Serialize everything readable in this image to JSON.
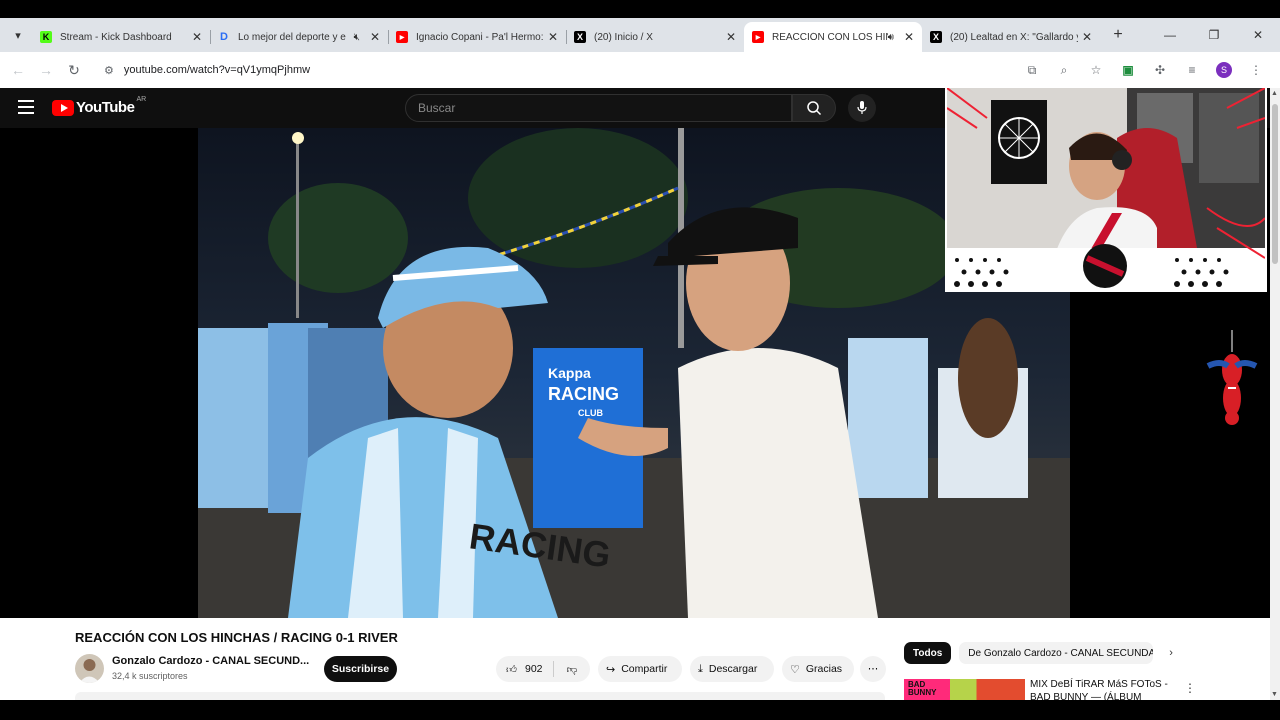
{
  "browser": {
    "tabs": [
      {
        "title": "Stream - Kick Dashboard",
        "favicon": "kick-icon",
        "active": false,
        "audio": ""
      },
      {
        "title": "Lo mejor del deporte y e",
        "favicon": "dplus-icon",
        "active": false,
        "audio": "muted"
      },
      {
        "title": "Ignacio Copani - Pa'l Hermo:",
        "favicon": "youtube-icon",
        "active": false,
        "audio": ""
      },
      {
        "title": "(20) Inicio / X",
        "favicon": "x-icon",
        "active": false,
        "audio": ""
      },
      {
        "title": "REACCIÓN CON LOS HIN",
        "favicon": "youtube-icon",
        "active": true,
        "audio": "playing"
      },
      {
        "title": "(20) Lealtad en X: \"Gallardo y",
        "favicon": "x-icon",
        "active": false,
        "audio": ""
      }
    ],
    "url": "youtube.com/watch?v=qV1ymqPjhmw",
    "profile_initial": "S"
  },
  "youtube": {
    "logo_text": "YouTube",
    "country": "AR",
    "search_placeholder": "Buscar"
  },
  "video": {
    "title": "REACCIÓN CON LOS HINCHAS / RACING 0-1 RIVER",
    "channel": "Gonzalo Cardozo - CANAL SECUND...",
    "subscribers": "32,4 k suscriptores",
    "subscribe_label": "Suscribirse",
    "likes": "902",
    "share_label": "Compartir",
    "download_label": "Descargar",
    "thanks_label": "Gracias",
    "jersey_text_1": "RACING",
    "jersey_text_2": "Kappa",
    "jersey_text_3": "RACING",
    "jersey_text_4": "CLUB"
  },
  "sidebar": {
    "chips": [
      "Todos",
      "De Gonzalo Cardozo - CANAL SECUNDARIO"
    ],
    "rec_title_1": "MIX DeBÍ TiRAR MáS FOToS -",
    "rec_title_2": "BAD BUNNY — (ÁLBUM",
    "rec_thumb_text_1": "BAD",
    "rec_thumb_text_2": "BUNNY"
  },
  "colors": {
    "youtube_red": "#ff0000",
    "racing_blue": "#6cb4e8",
    "profile_purple": "#7b2fbe"
  }
}
